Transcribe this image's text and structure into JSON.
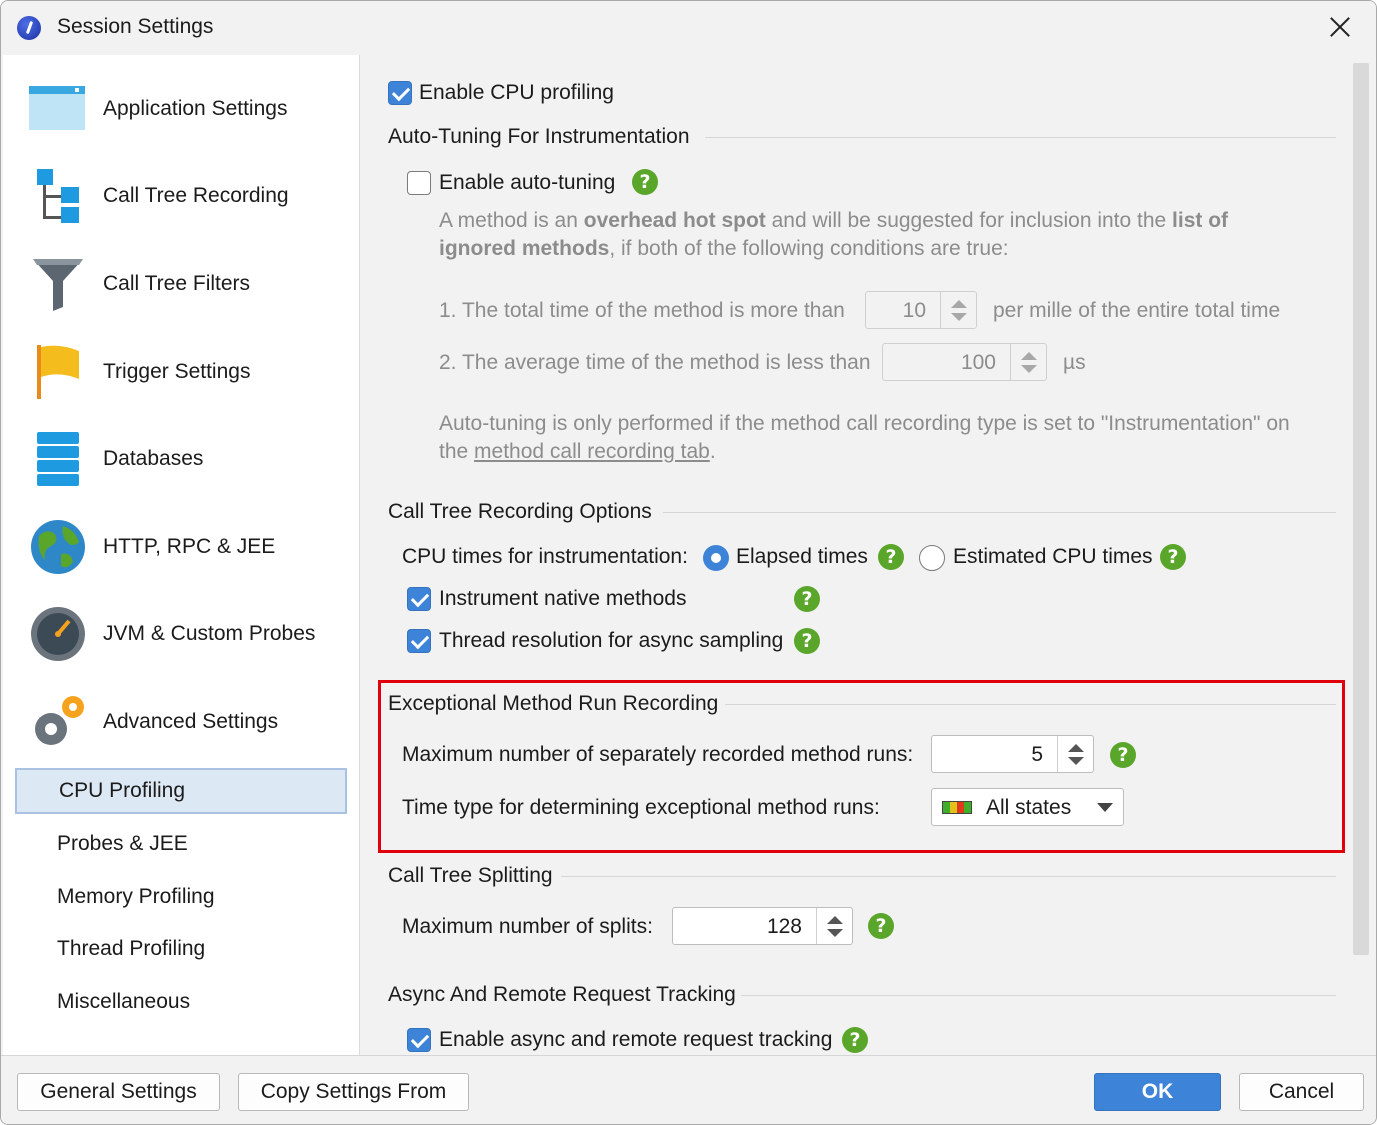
{
  "window": {
    "title": "Session Settings"
  },
  "sidebar": {
    "items": [
      {
        "label": "Application Settings",
        "icon": "application-window-icon"
      },
      {
        "label": "Call Tree Recording",
        "icon": "call-tree-icon"
      },
      {
        "label": "Call Tree Filters",
        "icon": "funnel-filter-icon"
      },
      {
        "label": "Trigger Settings",
        "icon": "flag-icon"
      },
      {
        "label": "Databases",
        "icon": "database-stack-icon"
      },
      {
        "label": "HTTP, RPC & JEE",
        "icon": "globe-icon"
      },
      {
        "label": "JVM & Custom Probes",
        "icon": "gauge-icon"
      },
      {
        "label": "Advanced Settings",
        "icon": "gears-icon"
      }
    ],
    "subitems": [
      {
        "label": "CPU Profiling",
        "selected": true
      },
      {
        "label": "Probes & JEE"
      },
      {
        "label": "Memory Profiling"
      },
      {
        "label": "Thread Profiling"
      },
      {
        "label": "Miscellaneous"
      }
    ]
  },
  "cpu": {
    "enable_label": "Enable CPU profiling",
    "enabled": true
  },
  "autotuning": {
    "section": "Auto-Tuning For Instrumentation",
    "enable_label": "Enable auto-tuning",
    "enabled": false,
    "desc_1": "A method is an ",
    "desc_bold_1": "overhead hot spot",
    "desc_2": " and will be suggested for inclusion into the ",
    "desc_bold_2": "list of",
    "desc_bold_3": "ignored methods",
    "desc_3": ", if both of the following conditions are true:",
    "cond1_label": "1. The total time of the method is more than",
    "cond1_value": "10",
    "cond1_unit": "per mille of the entire total time",
    "cond2_label": "2. The average time of the method is less than",
    "cond2_value": "100",
    "cond2_unit": "µs",
    "note_1": "Auto-tuning is only performed if the method call recording type is set to \"Instrumentation\" on",
    "note_2": "the ",
    "note_link": "method call recording tab",
    "note_3": "."
  },
  "recording": {
    "section": "Call Tree Recording Options",
    "cpu_times_label": "CPU times for instrumentation:",
    "elapsed_label": "Elapsed times",
    "estimated_label": "Estimated CPU times",
    "selected": "Elapsed times",
    "native_label": "Instrument native methods",
    "native_checked": true,
    "thread_label": "Thread resolution for async sampling",
    "thread_checked": true
  },
  "exceptional": {
    "section": "Exceptional Method Run Recording",
    "max_runs_label": "Maximum number of separately recorded method runs:",
    "max_runs_value": "5",
    "time_type_label": "Time type for determining exceptional method runs:",
    "time_type_value": "All states"
  },
  "splitting": {
    "section": "Call Tree Splitting",
    "max_splits_label": "Maximum number of splits:",
    "max_splits_value": "128"
  },
  "async": {
    "section": "Async And Remote Request Tracking",
    "enable_label": "Enable async and remote request tracking",
    "enabled": true
  },
  "footer": {
    "general_settings": "General Settings",
    "copy_settings": "Copy Settings From",
    "ok": "OK",
    "cancel": "Cancel"
  },
  "colors": {
    "accent": "#3d84d8",
    "help": "#5aa62a",
    "highlight": "#e0000b",
    "selected_bg": "#dde8f5"
  }
}
